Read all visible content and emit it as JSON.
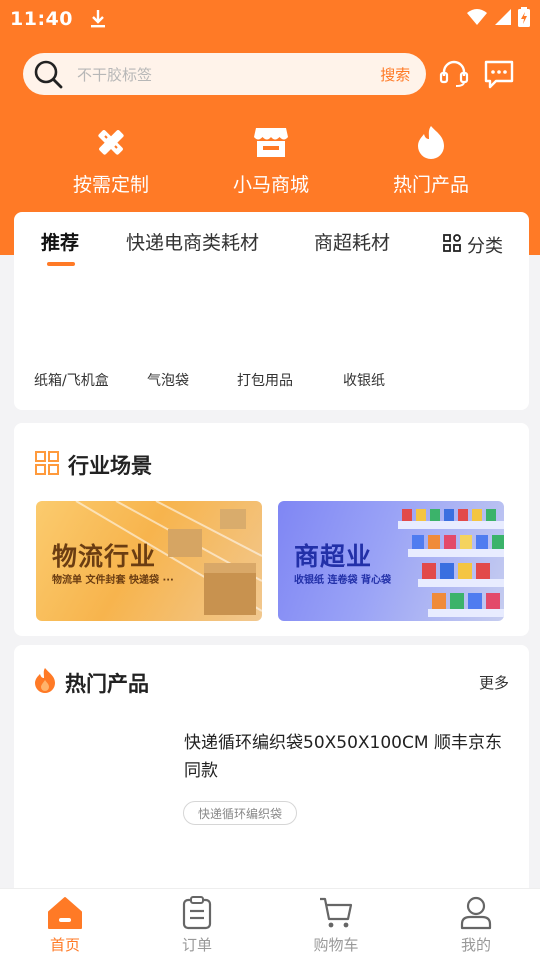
{
  "status_bar": {
    "time": "11:40"
  },
  "search": {
    "placeholder": "不干胶标签",
    "button": "搜索"
  },
  "quick_entries": [
    {
      "label": "按需定制",
      "icon": "pencil-ruler-icon"
    },
    {
      "label": "小马商城",
      "icon": "store-icon"
    },
    {
      "label": "热门产品",
      "icon": "flame-icon"
    }
  ],
  "tabs": [
    {
      "label": "推荐",
      "active": true
    },
    {
      "label": "快递电商类耗材",
      "active": false
    },
    {
      "label": "商超耗材",
      "active": false
    }
  ],
  "category_button": "分类",
  "subcategories": [
    "纸箱/飞机盒",
    "气泡袋",
    "打包用品",
    "收银纸"
  ],
  "scenes": {
    "title": "行业场景",
    "banners": [
      {
        "title": "物流行业",
        "subtitle": "物流单 文件封套 快递袋 ···"
      },
      {
        "title": "商超业",
        "subtitle": "收银纸 连卷袋 背心袋"
      }
    ]
  },
  "hot": {
    "title": "热门产品",
    "more": "更多",
    "product": {
      "title": "快递循环编织袋50X50X100CM 顺丰京东同款",
      "tag": "快递循环编织袋"
    }
  },
  "bottom_nav": [
    {
      "label": "首页",
      "icon": "home-icon",
      "active": true
    },
    {
      "label": "订单",
      "icon": "order-icon",
      "active": false
    },
    {
      "label": "购物车",
      "icon": "cart-icon",
      "active": false
    },
    {
      "label": "我的",
      "icon": "user-icon",
      "active": false
    }
  ],
  "colors": {
    "brand": "#ff7a26",
    "background": "#f3f3f5"
  }
}
